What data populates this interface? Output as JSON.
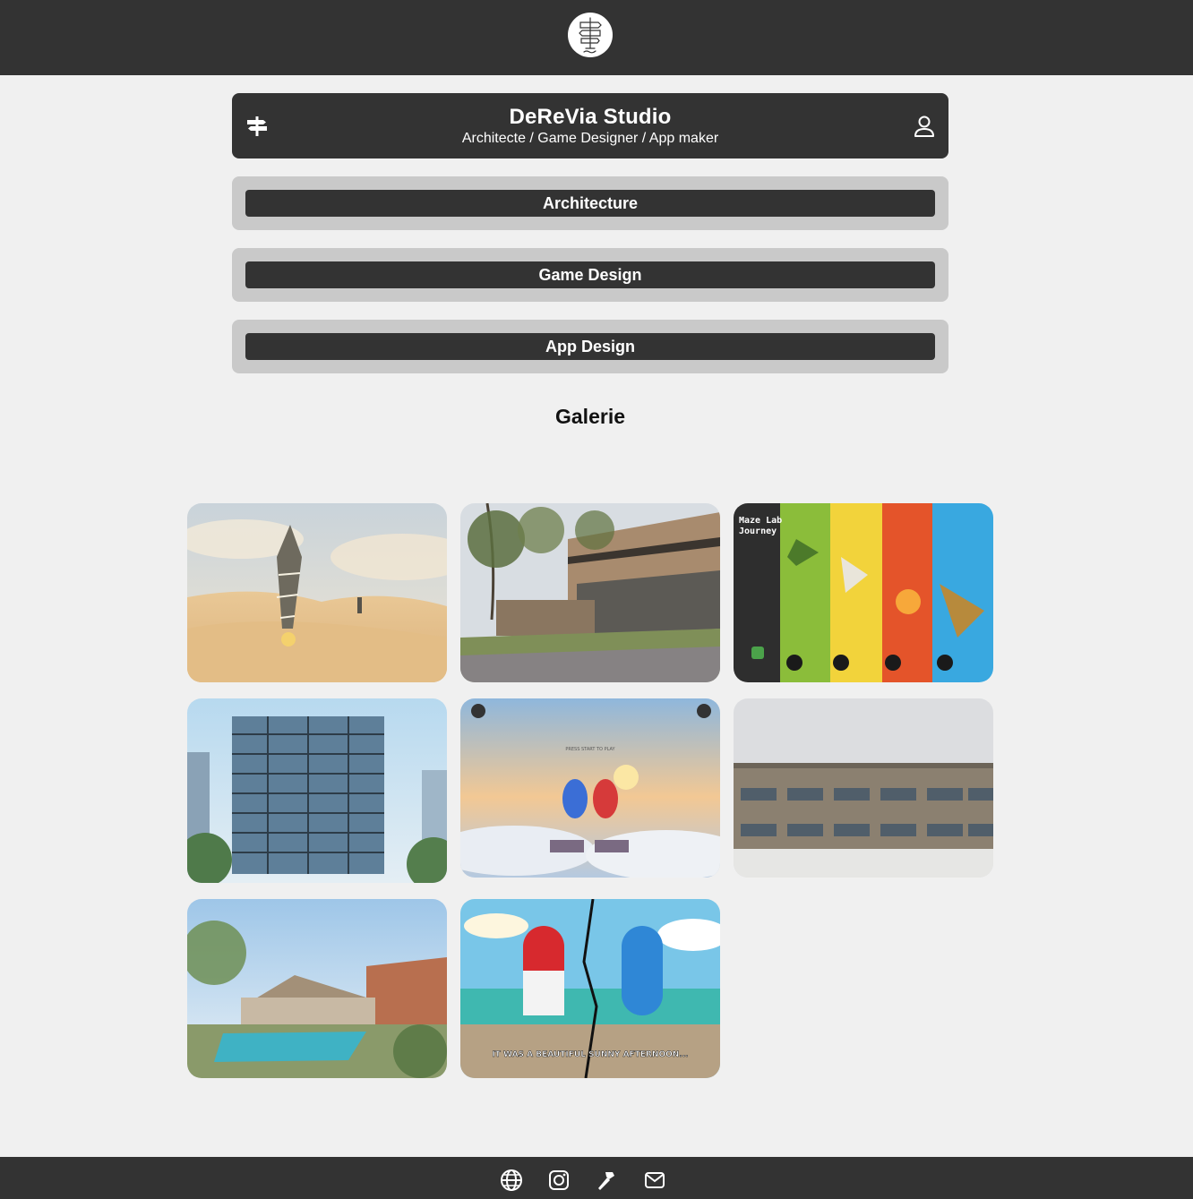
{
  "header": {
    "title": "DeReVia Studio",
    "subtitle": "Architecte / Game Designer / App maker",
    "menu_icon": "signpost-icon",
    "user_icon": "user-icon"
  },
  "categories": [
    {
      "label": "Architecture"
    },
    {
      "label": "Game Design"
    },
    {
      "label": "App Design"
    }
  ],
  "gallery": {
    "title": "Galerie",
    "captions": {
      "maze_title": "Maze Lab Journey",
      "press_start": "PRESS START TO PLAY",
      "comic_caption": "IT WAS A BEAUTIFUL SUNNY AFTERNOON..."
    }
  },
  "footer": {
    "icons": [
      "globe-icon",
      "instagram-icon",
      "hammer-icon",
      "mail-icon"
    ]
  },
  "colors": {
    "dark": "#333333",
    "block": "#c9c9c9",
    "page_bg": "#f0f0f0"
  }
}
